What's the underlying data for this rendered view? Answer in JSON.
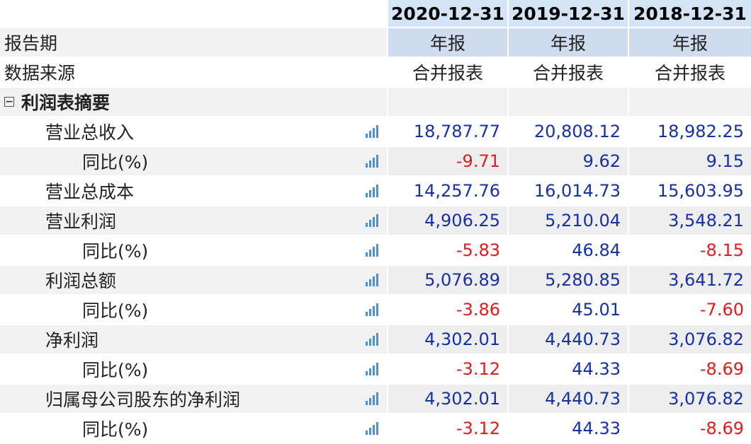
{
  "header": {
    "periods": [
      "2020-12-31",
      "2019-12-31",
      "2018-12-31"
    ]
  },
  "report_period": {
    "label": "报告期",
    "values": [
      "年报",
      "年报",
      "年报"
    ]
  },
  "data_source": {
    "label": "数据来源",
    "values": [
      "合并报表",
      "合并报表",
      "合并报表"
    ]
  },
  "section": {
    "label": "利润表摘要",
    "toggle": "⊟"
  },
  "rows": [
    {
      "label": "营业总收入",
      "values": [
        "18,787.77",
        "20,808.12",
        "18,982.25"
      ],
      "signs": [
        "pos",
        "pos",
        "pos"
      ]
    },
    {
      "label": "同比(%)",
      "values": [
        "-9.71",
        "9.62",
        "9.15"
      ],
      "signs": [
        "neg",
        "pos",
        "pos"
      ]
    },
    {
      "label": "营业总成本",
      "values": [
        "14,257.76",
        "16,014.73",
        "15,603.95"
      ],
      "signs": [
        "pos",
        "pos",
        "pos"
      ]
    },
    {
      "label": "营业利润",
      "values": [
        "4,906.25",
        "5,210.04",
        "3,548.21"
      ],
      "signs": [
        "pos",
        "pos",
        "pos"
      ]
    },
    {
      "label": "同比(%)",
      "values": [
        "-5.83",
        "46.84",
        "-8.15"
      ],
      "signs": [
        "neg",
        "pos",
        "neg"
      ]
    },
    {
      "label": "利润总额",
      "values": [
        "5,076.89",
        "5,280.85",
        "3,641.72"
      ],
      "signs": [
        "pos",
        "pos",
        "pos"
      ]
    },
    {
      "label": "同比(%)",
      "values": [
        "-3.86",
        "45.01",
        "-7.60"
      ],
      "signs": [
        "neg",
        "pos",
        "neg"
      ]
    },
    {
      "label": "净利润",
      "values": [
        "4,302.01",
        "4,440.73",
        "3,076.82"
      ],
      "signs": [
        "pos",
        "pos",
        "pos"
      ]
    },
    {
      "label": "同比(%)",
      "values": [
        "-3.12",
        "44.33",
        "-8.69"
      ],
      "signs": [
        "neg",
        "pos",
        "neg"
      ]
    },
    {
      "label": "归属母公司股东的净利润",
      "values": [
        "4,302.01",
        "4,440.73",
        "3,076.82"
      ],
      "signs": [
        "pos",
        "pos",
        "pos"
      ]
    },
    {
      "label": "同比(%)",
      "values": [
        "-3.12",
        "44.33",
        "-8.69"
      ],
      "signs": [
        "neg",
        "pos",
        "neg"
      ]
    }
  ],
  "icons": {
    "chart": "bar-chart-icon",
    "collapse": "collapse-icon"
  },
  "colors": {
    "positive": "#1530a8",
    "negative": "#e31b1b",
    "header_bg": "#d5e3f7",
    "chart_icon": "#4a8fd8"
  }
}
